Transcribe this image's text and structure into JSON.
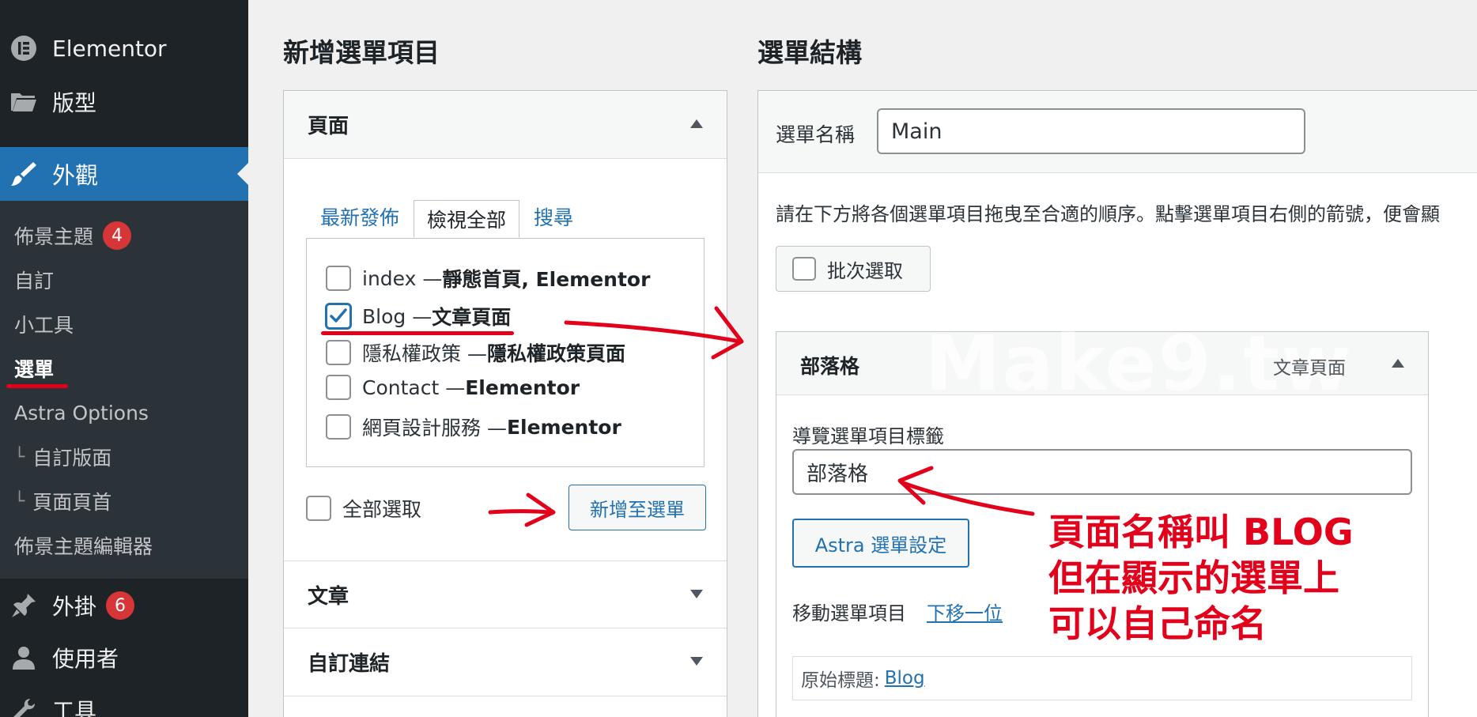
{
  "sidebar": {
    "top": [
      {
        "label": "Elementor",
        "icon": "elementor-icon"
      },
      {
        "label": "版型",
        "icon": "folder-icon"
      }
    ],
    "active": {
      "label": "外觀",
      "icon": "paintbrush-icon"
    },
    "submenu": [
      {
        "label": "佈景主題",
        "badge": "4"
      },
      {
        "label": "自訂"
      },
      {
        "label": "小工具"
      },
      {
        "label": "選單"
      },
      {
        "label": "Astra Options"
      },
      {
        "label": "自訂版面",
        "indent": "└"
      },
      {
        "label": "頁面頁首",
        "indent": "└"
      },
      {
        "label": "佈景主題編輯器"
      }
    ],
    "bottom": [
      {
        "label": "外掛",
        "badge": "6",
        "icon": "plugin-icon"
      },
      {
        "label": "使用者",
        "icon": "user-icon"
      },
      {
        "label": "工具",
        "icon": "wrench-icon"
      }
    ]
  },
  "add_section": {
    "title": "新增選單項目",
    "pages_header": "頁面",
    "tabs": [
      "最新發佈",
      "檢視全部",
      "搜尋"
    ],
    "pages": [
      {
        "name": "index — ",
        "type": "靜態首頁, Elementor",
        "checked": false
      },
      {
        "name": "Blog — ",
        "type": "文章頁面",
        "checked": true
      },
      {
        "name": "隱私權政策 — ",
        "type": "隱私權政策頁面",
        "checked": false
      },
      {
        "name": "Contact — ",
        "type": "Elementor",
        "checked": false
      },
      {
        "name": "網頁設計服務 — ",
        "type": "Elementor",
        "checked": false
      }
    ],
    "select_all": "全部選取",
    "add_button": "新增至選單",
    "posts_header": "文章",
    "custom_links_header": "自訂連結"
  },
  "structure_section": {
    "title": "選單結構",
    "menu_name_label": "選單名稱",
    "menu_name_value": "Main",
    "instruction": "請在下方將各個選單項目拖曳至合適的順序。點擊選單項目右側的箭號，便會顯",
    "bulk_select": "批次選取",
    "menu_item": {
      "title": "部落格",
      "type": "文章頁面",
      "nav_label_caption": "導覽選單項目標籤",
      "nav_label_value": "部落格",
      "astra_button": "Astra 選單設定",
      "move_label": "移動選單項目",
      "move_link": "下移一位",
      "original_label": "原始標題:",
      "original_link": "Blog"
    },
    "watermark": "Make9.tw"
  },
  "annotation": {
    "text": "頁面名稱叫 BLOG\n但在顯示的選單上\n可以自己命名",
    "color": "#e3001b"
  },
  "colors": {
    "sidebar_bg": "#1d2327",
    "submenu_bg": "#2c3338",
    "accent": "#2271b1",
    "badge": "#d63638"
  }
}
